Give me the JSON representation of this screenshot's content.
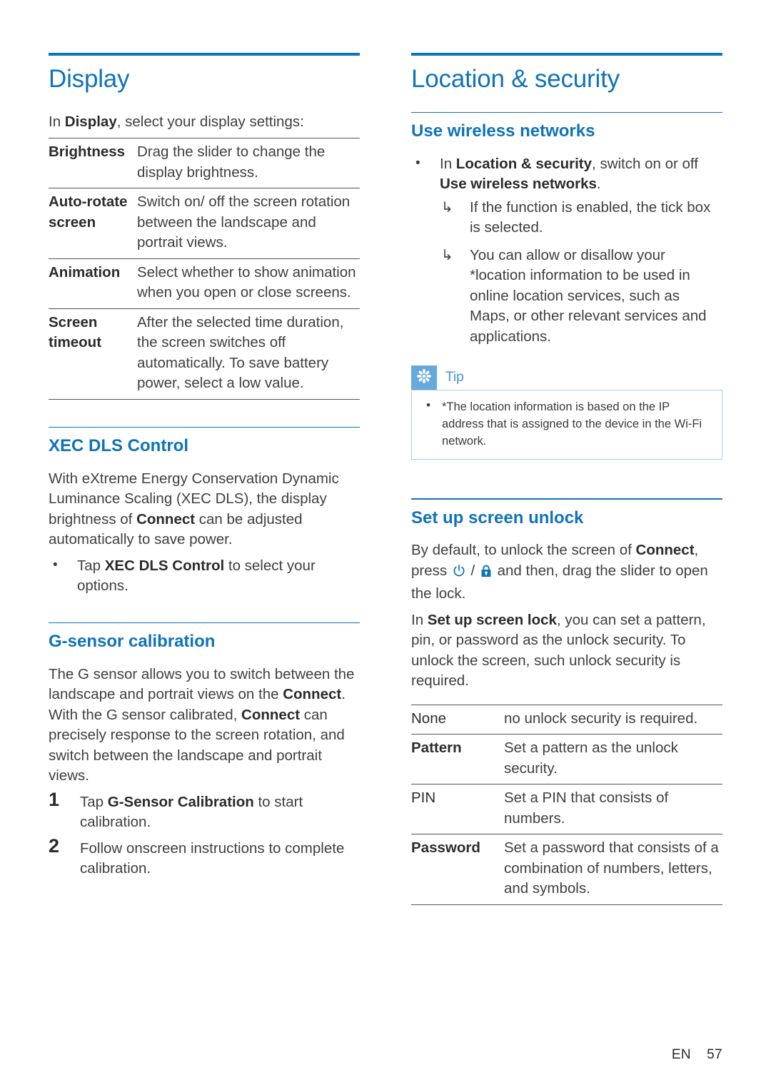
{
  "document": {
    "footer": {
      "language": "EN",
      "page": "57"
    }
  },
  "left_column": {
    "chapter_title": "Display",
    "intro_pre": "In ",
    "intro_bold": "Display",
    "intro_post": ", select your display settings:",
    "display_table": {
      "rows": [
        {
          "term": "Brightness",
          "desc": "Drag the slider to change the display brightness."
        },
        {
          "term": "Auto-rotate screen",
          "desc": "Switch on/ off the screen rotation between the landscape and portrait views."
        },
        {
          "term": "Animation",
          "desc": "Select whether to show animation when you open or close screens."
        },
        {
          "term": "Screen timeout",
          "desc": "After the selected time duration, the screen switches off automatically. To save battery power, select a low value."
        }
      ]
    },
    "xec": {
      "heading": "XEC DLS Control",
      "paragraph_1": "With eXtreme Energy Conservation Dynamic Luminance Scaling (XEC DLS), the display brightness of ",
      "paragraph_1_bold": "Connect",
      "paragraph_1_post": " can be adjusted automatically to save power.",
      "bullet_pre": "Tap ",
      "bullet_bold": "XEC DLS Control",
      "bullet_post": " to select your options."
    },
    "gsensor": {
      "heading": "G-sensor calibration",
      "p1_a": "The G sensor allows you to switch between the landscape and portrait views on the ",
      "p1_b1": "Connect",
      "p1_b": ". With the G sensor calibrated, ",
      "p1_b2": "Connect",
      "p1_c": " can precisely response to the screen rotation, and switch between the landscape and portrait views.",
      "steps": [
        {
          "num": "1",
          "pre": "Tap ",
          "bold": "G-Sensor Calibration",
          "post": " to start calibration."
        },
        {
          "num": "2",
          "pre": "Follow onscreen instructions to complete calibration.",
          "bold": "",
          "post": ""
        }
      ]
    }
  },
  "right_column": {
    "chapter_title": "Location & security",
    "wireless": {
      "heading": "Use wireless networks",
      "bullet_pre": "In ",
      "bullet_bold": "Location & security",
      "bullet_mid": ", switch on or off ",
      "bullet_bold2": "Use wireless networks",
      "bullet_post": ".",
      "sub_items": [
        "If the function is enabled, the tick box is selected.",
        "You can allow or disallow your *location information to be used in online location services, such as Maps, or other relevant services and applications."
      ]
    },
    "tip": {
      "label": "Tip",
      "icon": "asterisk-flower-icon",
      "text": "*The location information is based on the IP address that is assigned to the device in the Wi-Fi network."
    },
    "unlock": {
      "heading": "Set up screen unlock",
      "p1_pre": "By default, to unlock the screen of ",
      "p1_bold": "Connect",
      "p1_mid": ", press ",
      "icon_power": "power-icon",
      "icon_sep": " / ",
      "icon_lock": "lock-icon",
      "p1_post": " and then, drag the slider to open the lock.",
      "p2_pre": "In ",
      "p2_bold": "Set up screen lock",
      "p2_post": ", you can set a pattern, pin, or password as the unlock security. To unlock the screen, such unlock security is required.",
      "table": {
        "rows": [
          {
            "term": "None",
            "desc": "no unlock security is required."
          },
          {
            "term": "Pattern",
            "desc": "Set a pattern as the unlock security."
          },
          {
            "term": "PIN",
            "desc": "Set a PIN that consists of numbers."
          },
          {
            "term": "Password",
            "desc": "Set a password that consists of a combination of numbers, letters, and symbols."
          }
        ]
      }
    }
  },
  "colors": {
    "accent_blue": "#0f73b8",
    "tip_badge_blue": "#66a9dd",
    "tip_border_blue": "#a9cfe9",
    "rule_dark": "#5a5250",
    "body_text": "#3f3f3f"
  }
}
